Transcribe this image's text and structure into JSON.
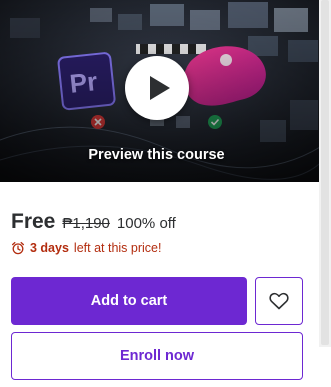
{
  "preview": {
    "label": "Preview this course",
    "play_icon": "play-icon",
    "app_badge_text": "Pr"
  },
  "pricing": {
    "current": "Free",
    "original": "₱1,190",
    "discount": "100% off"
  },
  "deadline": {
    "icon": "alarm-clock-icon",
    "emphasis": "3 days",
    "rest": "left at this price!"
  },
  "actions": {
    "add_to_cart": "Add to cart",
    "enroll_now": "Enroll now",
    "wishlist_icon": "heart-icon"
  },
  "colors": {
    "primary": "#6d28d2",
    "alert": "#b32d0f",
    "text": "#2d2f31"
  }
}
